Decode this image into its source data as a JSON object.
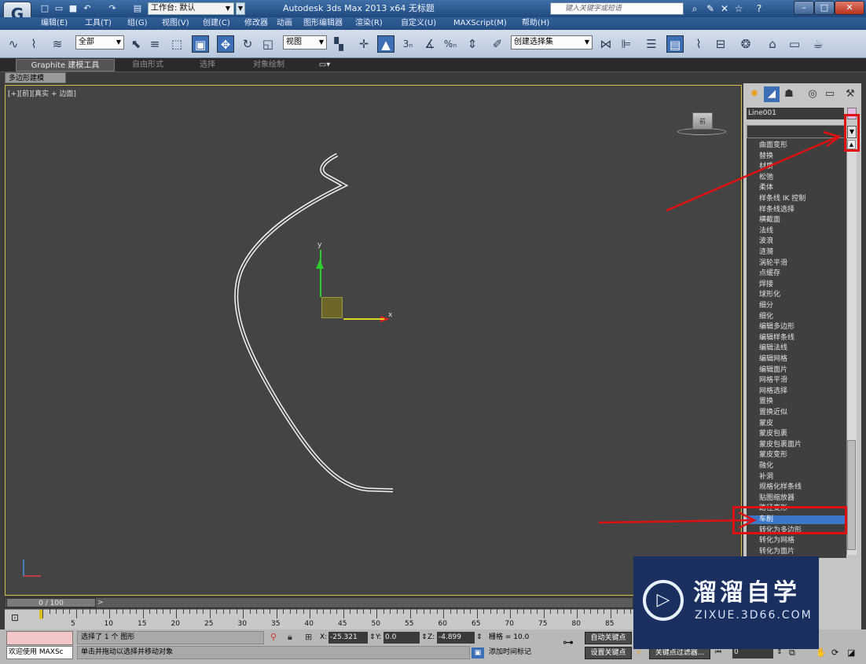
{
  "titlebar": {
    "workspace_label": "工作台: 默认",
    "app_title": "Autodesk 3ds Max  2013 x64    无标题",
    "search_placeholder": "键入关键字或短语"
  },
  "menus": [
    "编辑(E)",
    "工具(T)",
    "组(G)",
    "视图(V)",
    "创建(C)",
    "修改器",
    "动画",
    "图形编辑器",
    "渲染(R)",
    "自定义(U)",
    "MAXScript(M)",
    "帮助(H)"
  ],
  "toolbar": {
    "selection_filter": "全部",
    "ref_coord": "视图",
    "named_selection": "创建选择集",
    "snap_3": "3",
    "snap_percent": "%"
  },
  "ribbon": {
    "tabs": [
      "Graphite 建模工具",
      "自由形式",
      "选择",
      "对象绘制"
    ],
    "subtab": "多边形建模"
  },
  "viewport": {
    "label": "[+][前][真实 + 边面]",
    "viewcube_face": "前",
    "axis_x": "x",
    "axis_y": "y"
  },
  "command_panel": {
    "object_name": "Line001",
    "modifier_list": [
      "曲面变形",
      "替换",
      "材质",
      "松弛",
      "柔体",
      "样条线 IK 控制",
      "样条线选择",
      "横截面",
      "法线",
      "波浪",
      "涟漪",
      "涡轮平滑",
      "点缓存",
      "焊接",
      "球形化",
      "细分",
      "细化",
      "编辑多边形",
      "编辑样条线",
      "编辑法线",
      "编辑网格",
      "编辑面片",
      "网格平滑",
      "网格选择",
      "置换",
      "置换近似",
      "蒙皮",
      "蒙皮包裹",
      "蒙皮包裹面片",
      "蒙皮变形",
      "融化",
      "补洞",
      "规格化样条线",
      "贴图缩放器",
      "路径变形",
      "车削",
      "转化为多边形",
      "转化为网格",
      "转化为面片"
    ],
    "selected_modifier": "车削"
  },
  "timeline": {
    "frame_display": "0 / 100",
    "track_labels": [
      "5",
      "10",
      "15",
      "20",
      "25",
      "30",
      "35",
      "40",
      "45",
      "50",
      "55",
      "60",
      "65",
      "70",
      "75",
      "80",
      "85"
    ]
  },
  "status": {
    "maxscript_welcome": "欢迎使用 MAXSc",
    "selection_info": "选择了 1 个 图形",
    "prompt": "单击并拖动以选择并移动对象",
    "x_label": "X:",
    "x_value": "-25.321",
    "y_label": "Y:",
    "y_value": "0.0",
    "z_label": "Z:",
    "z_value": "-4.899",
    "grid": "栅格 = 10.0",
    "auto_key": "自动关键点",
    "set_key": "设置关键点",
    "key_filter": "关键点过滤器...",
    "add_time_tag": "添加时间标记",
    "current_frame": "0"
  },
  "watermark": {
    "title": "溜溜自学",
    "subtitle": "ZIXUE.3D66.COM"
  }
}
